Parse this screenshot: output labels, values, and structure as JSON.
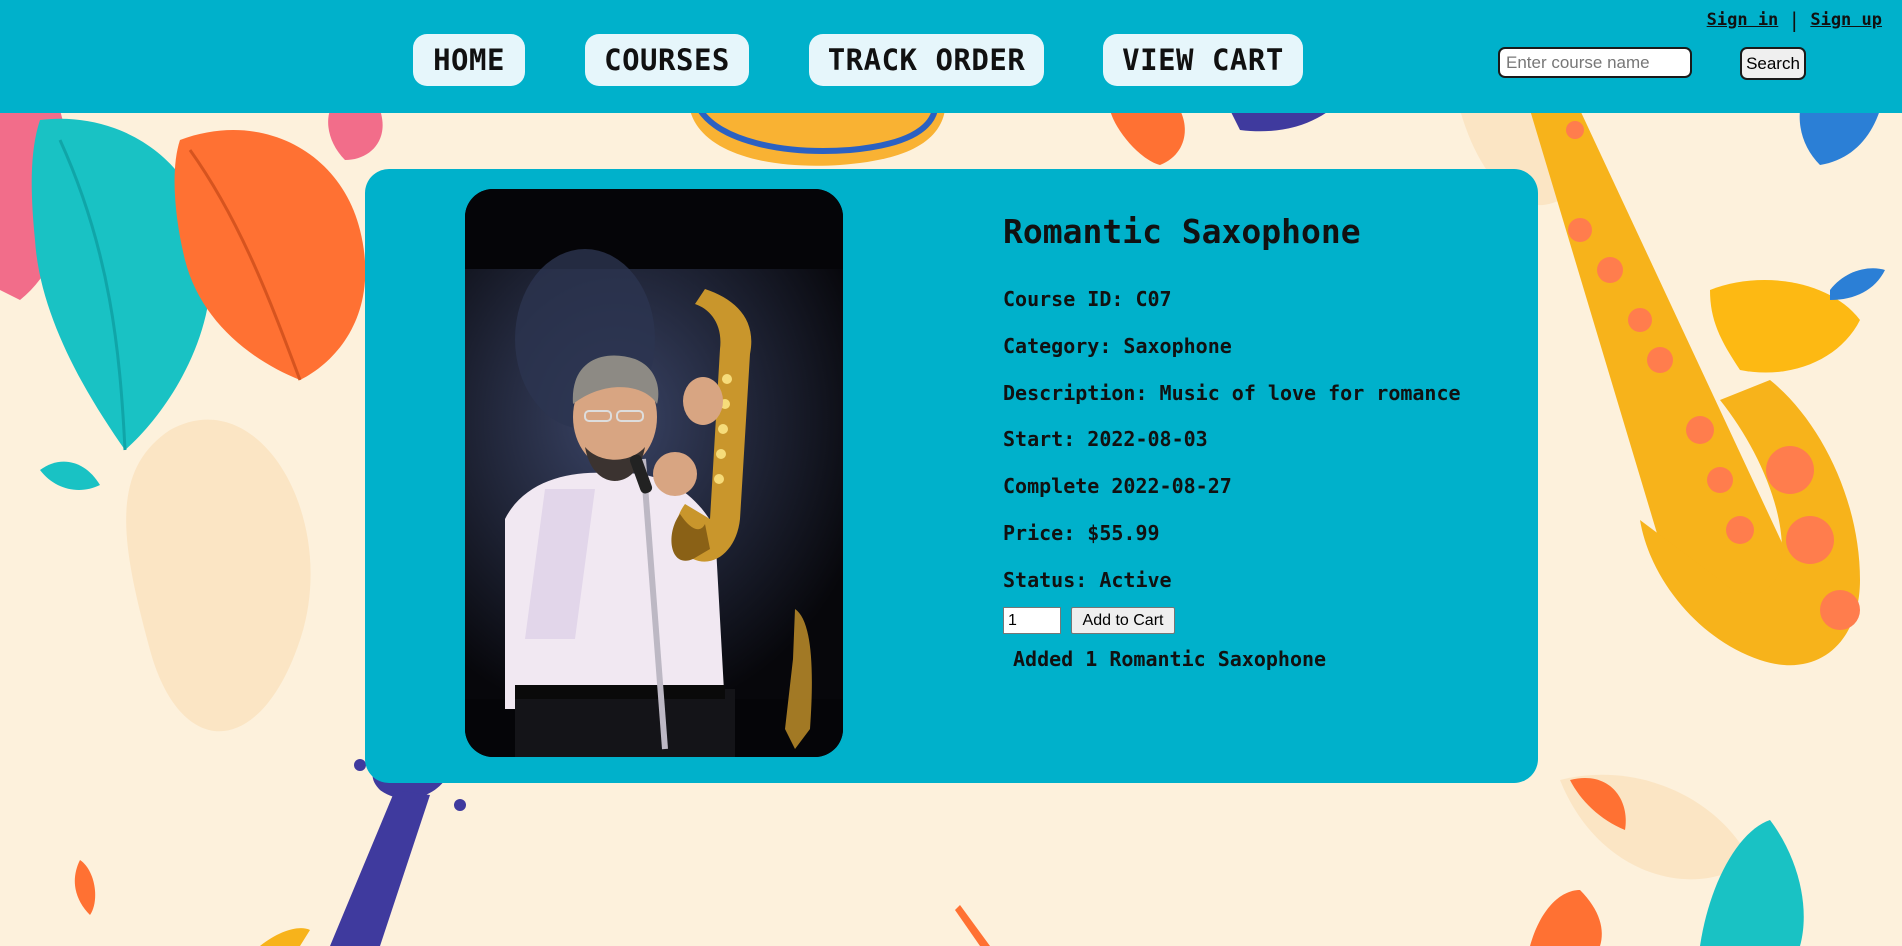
{
  "nav": {
    "items": [
      {
        "label": "HOME"
      },
      {
        "label": "COURSES"
      },
      {
        "label": "TRACK ORDER"
      },
      {
        "label": "VIEW CART"
      }
    ]
  },
  "auth": {
    "sign_in": "Sign in",
    "separator": "|",
    "sign_up": "Sign up"
  },
  "search": {
    "placeholder": "Enter course name",
    "value": "",
    "button_label": "Search"
  },
  "course": {
    "title": "Romantic Saxophone",
    "id_line": "Course ID: C07",
    "category_line": "Category: Saxophone",
    "description_line": "Description: Music of love for romance",
    "start_line": "Start: 2022-08-03",
    "complete_line": "Complete 2022-08-27",
    "price_line": "Price: $55.99",
    "status_line": "Status: Active"
  },
  "cart": {
    "quantity": "1",
    "add_label": "Add to Cart",
    "confirmation": "Added 1 Romantic Saxophone"
  },
  "colors": {
    "header_bg": "#00b1cb",
    "card_bg": "#00b1cb",
    "page_bg": "#fdf1dc",
    "nav_button_bg": "#e6f6fb"
  }
}
